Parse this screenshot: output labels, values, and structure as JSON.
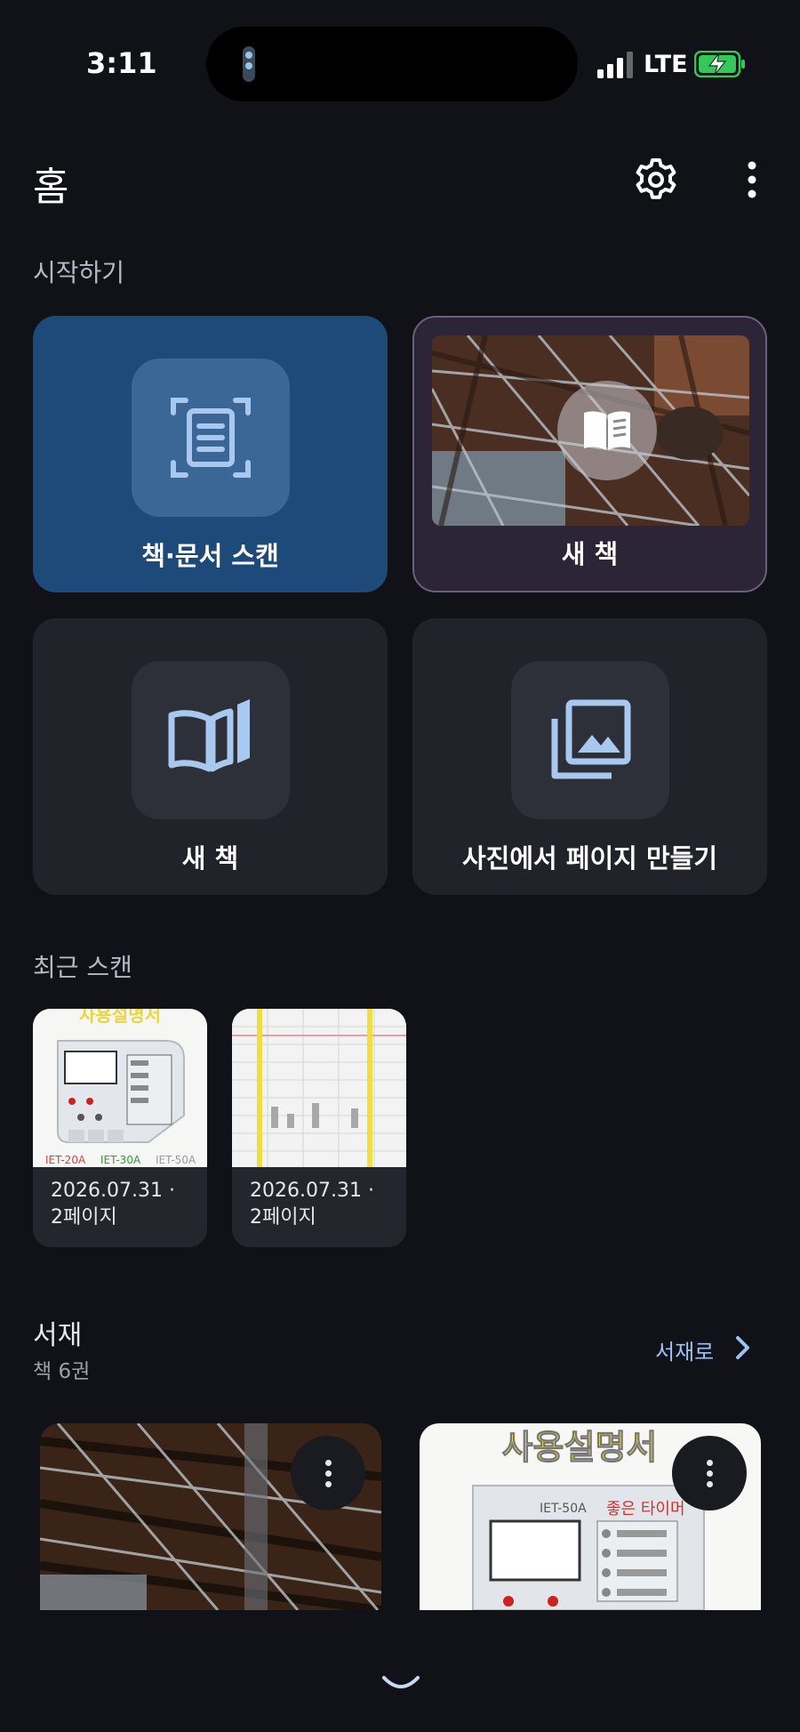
{
  "status_bar": {
    "time": "3:11",
    "network": "LTE"
  },
  "header": {
    "title": "홈"
  },
  "start_section": {
    "label": "시작하기",
    "tiles": [
      {
        "label": "책·문서 스캔",
        "icon": "document-scan-icon"
      },
      {
        "label": "새 책",
        "icon": "book-icon"
      },
      {
        "label": "새 책",
        "icon": "open-book-icon"
      },
      {
        "label": "사진에서 페이지 만들기",
        "icon": "photo-library-icon"
      }
    ]
  },
  "recent_section": {
    "label": "최근 스캔",
    "items": [
      {
        "date": "2026.07.31 ·",
        "pages": "2페이지"
      },
      {
        "date": "2026.07.31 ·",
        "pages": "2페이지"
      }
    ]
  },
  "library_section": {
    "title": "서재",
    "count": "책 6권",
    "link_label": "서재로",
    "books": [
      {
        "thumb": "rafters-photo"
      },
      {
        "thumb": "manual-cover",
        "cover_text": "사용설명서",
        "brand_text": "좋은 타이머",
        "model_text": "IET-50A"
      }
    ]
  },
  "manual_thumb": {
    "title": "사용설명서",
    "models": [
      "IET-20A",
      "IET-30A",
      "IET-50A"
    ]
  },
  "colors": {
    "background": "#101217",
    "scan_tile": "#1e4a79",
    "accent_link": "#9ec2f2",
    "battery_green": "#34c759"
  }
}
